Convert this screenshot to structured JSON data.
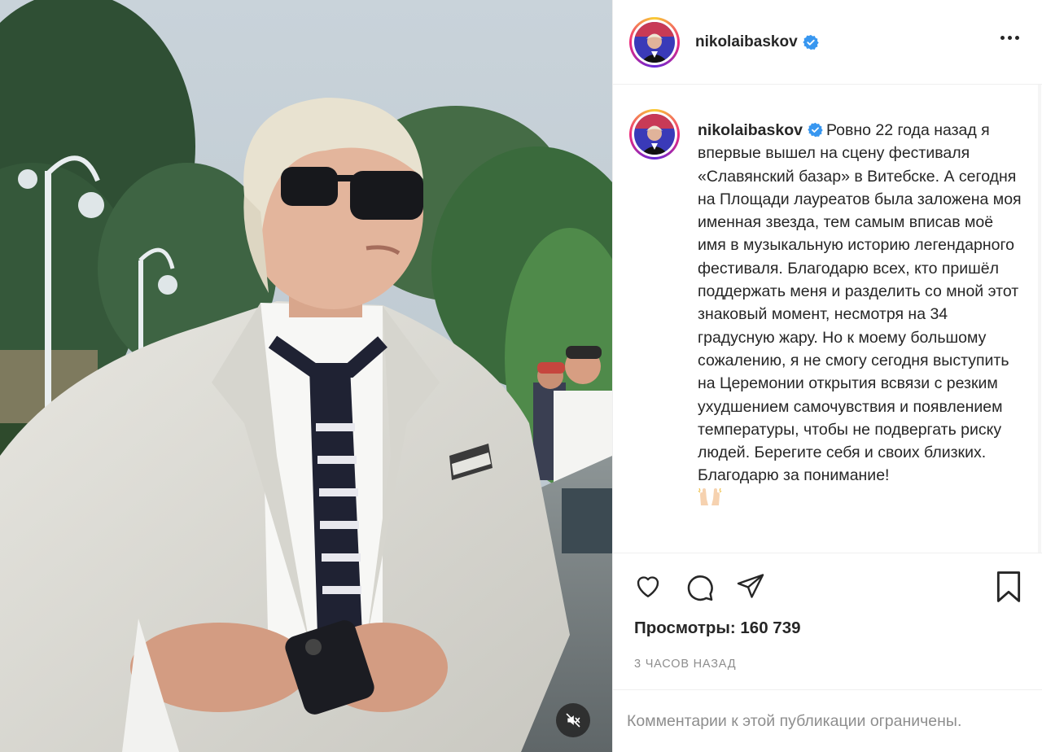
{
  "post": {
    "username": "nikolaibaskov",
    "verified": true,
    "caption": "Ровно 22 года назад я впервые вышел на сцену фестиваля «Славянский базар» в Витебске. А сегодня на Площади лауреатов была заложена моя именная звезда, тем самым вписав моё имя в музыкальную историю легендарного фестиваля. Благодарю всех, кто пришёл поддержать меня и разделить со мной этот знаковый момент, несмотря на 34 градусную жару. Но к моему большому сожалению, я не смогу сегодня выступить на Церемонии открытия всвязи с резким ухудшением самочувствия и появлением температуры, чтобы не подвергать риску людей. Берегите себя и своих близких. Благодарю за понимание!",
    "caption_emoji": "raised-hands-emoji",
    "views_label": "Просмотры: 160 739",
    "time_ago": "3 часов назад",
    "comments_disabled_text": "Комментарии к этой публикации ограничены."
  },
  "icons": {
    "more": "more-horizontal-icon",
    "like": "heart-icon",
    "comment": "comment-icon",
    "share": "paper-plane-icon",
    "save": "bookmark-icon",
    "mute": "speaker-muted-icon",
    "verified": "verified-badge-icon"
  },
  "colors": {
    "verified": "#3897f0",
    "text": "#262626",
    "secondary": "#8e8e8e",
    "border": "#efefef"
  }
}
